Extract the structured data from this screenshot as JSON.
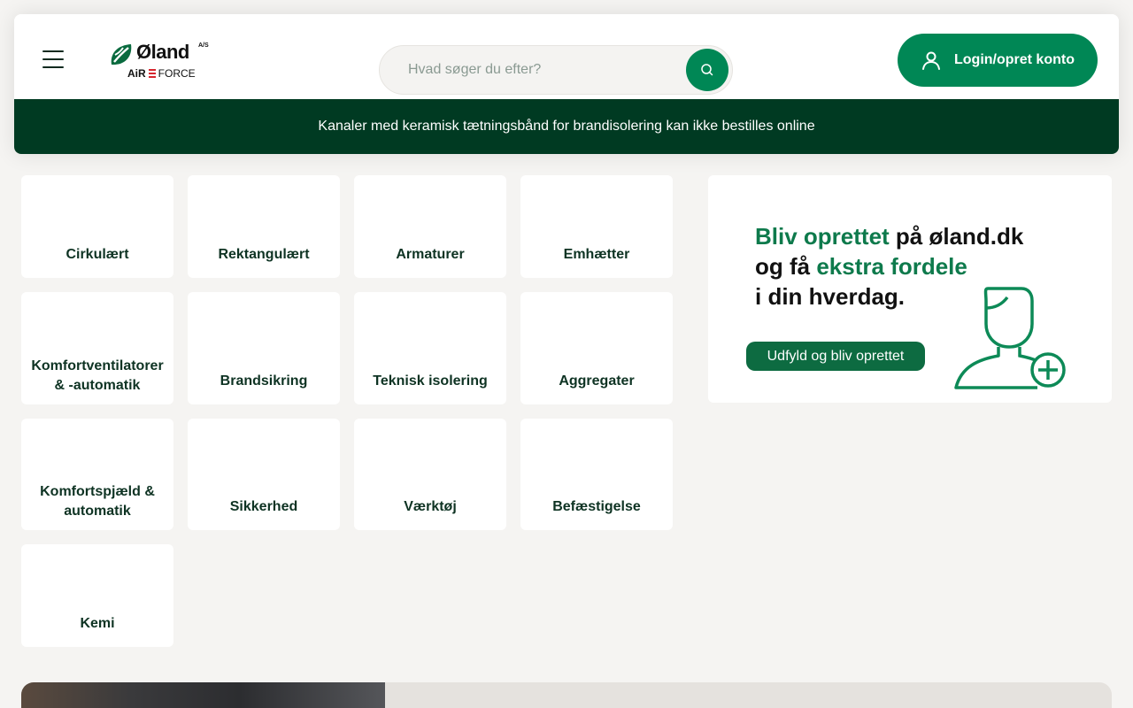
{
  "header": {
    "logo": {
      "name": "Øland",
      "suffix": "A/S",
      "sub_air": "AiR",
      "sub_force": "FORCE"
    },
    "search": {
      "placeholder": "Hvad søger du efter?"
    },
    "login_label": "Login/opret konto"
  },
  "notice": {
    "text": "Kanaler med keramisk tætningsbånd for brandisolering kan ikke bestilles online"
  },
  "categories": [
    "Cirkulært",
    "Rektangulært",
    "Armaturer",
    "Emhætter",
    "Komfortventilatorer & -automatik",
    "Brandsikring",
    "Teknisk isolering",
    "Aggregater",
    "Komfortspjæld & automatik",
    "Sikkerhed",
    "Værktøj",
    "Befæstigelse",
    "Kemi"
  ],
  "banner": {
    "line1_green": "Bliv oprettet",
    "line1_black": " på øland.dk",
    "line2_black": "og få ",
    "line2_green": "ekstra fordele",
    "line3": "i din hverdag.",
    "cta": "Udfyld og bliv oprettet"
  },
  "colors": {
    "brand_green": "#008755",
    "dark_green": "#003a22",
    "text": "#0e3323",
    "background": "#f5f4f2"
  }
}
